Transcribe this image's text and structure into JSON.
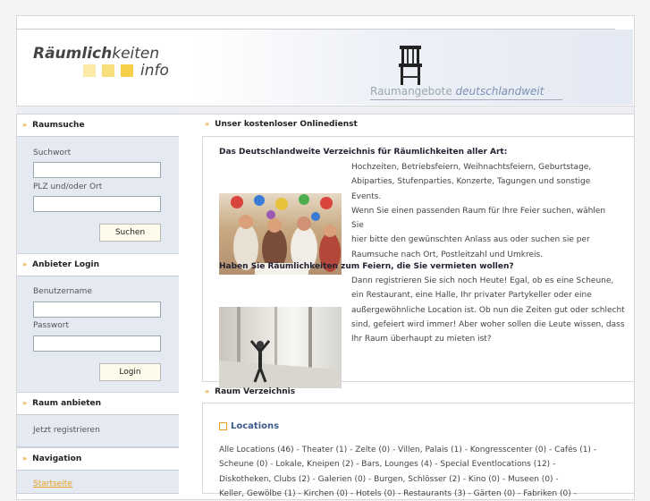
{
  "header": {
    "logo_part1": "Räumlich",
    "logo_part2": "keiten",
    "logo_part3": "info",
    "tagline_plain": "Raumangebote ",
    "tagline_italic": "deutschlandweit",
    "logo_square_colors": [
      "#fbe9a8",
      "#f9df7c",
      "#f7d04a"
    ]
  },
  "sidebar": {
    "search": {
      "title": "Raumsuche",
      "keyword_label": "Suchwort",
      "keyword_value": "",
      "location_label": "PLZ und/oder Ort",
      "location_value": "",
      "button": "Suchen"
    },
    "login": {
      "title": "Anbieter Login",
      "user_label": "Benutzername",
      "user_value": "",
      "pass_label": "Passwort",
      "pass_value": "",
      "button": "Login"
    },
    "offer": {
      "title": "Raum anbieten",
      "link": "Jetzt registrieren"
    },
    "navigation": {
      "title": "Navigation",
      "items": [
        "Startseite"
      ]
    }
  },
  "main": {
    "service": {
      "title": "Unser kostenloser Onlinedienst",
      "sub1": "Das Deutschlandweite Verzeichnis für Räumlichkeiten aller Art:",
      "para1": [
        "Hochzeiten, Betriebsfeiern, Weihnachtsfeiern, Geburtstage,",
        "Abiparties, Stufenparties, Konzerte, Tagungen und sonstige Events.",
        "Wenn Sie einen passenden Raum für Ihre Feier suchen, wählen Sie",
        "hier bitte den gewünschten Anlass aus oder suchen sie per",
        "Raumsuche nach Ort, Postleitzahl und Umkreis."
      ],
      "sub2": "Haben Sie Räumlichkeiten zum Feiern, die Sie vermieten wollen?",
      "para2": [
        "Dann registrieren Sie sich noch Heute! Egal, ob es eine Scheune,",
        "ein Restaurant, eine Halle, Ihr privater Partykeller oder eine",
        "außergewöhnliche Location ist. Ob nun die Zeiten gut oder schlecht",
        "sind, gefeiert wird immer! Aber woher sollen die Leute wissen, dass",
        "Ihr Raum überhaupt zu mieten ist?"
      ]
    },
    "directory": {
      "title": "Raum Verzeichnis",
      "locations_title": "Locations",
      "lines": [
        "Alle Locations (46) - Theater (1) - Zelte (0) - Villen, Palais (1) - Kongresscenter (0) - Cafés (1) -",
        "Scheune (0) - Lokale, Kneipen (2) - Bars, Lounges (4) - Special Eventlocations (12) -",
        "Diskotheken, Clubs (2) - Galerien (0) - Burgen, Schlösser (2) - Kino (0) - Museen (0) -",
        "Keller, Gewölbe (1) - Kirchen (0) - Hotels (0) - Restaurants (3) - Gärten (0) - Fabriken (0) -"
      ]
    }
  }
}
